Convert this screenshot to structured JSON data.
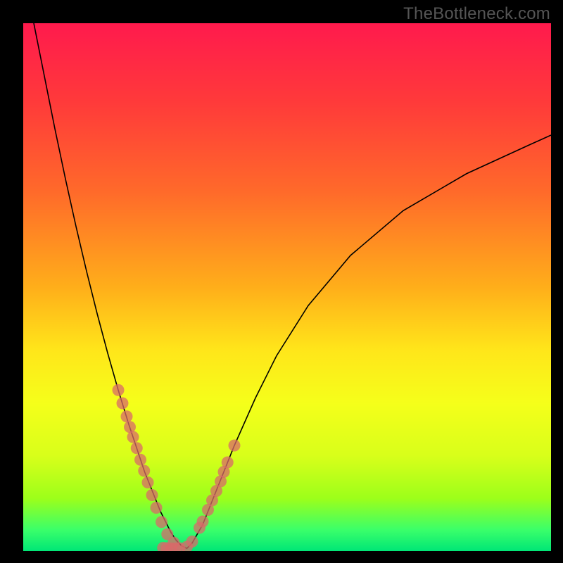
{
  "watermark": "TheBottleneck.com",
  "chart_data": {
    "type": "line",
    "title": "",
    "xlabel": "",
    "ylabel": "",
    "xlim": [
      0,
      100
    ],
    "ylim": [
      0,
      100
    ],
    "curve": {
      "name": "bottleneck-curve",
      "x": [
        2,
        4,
        6,
        8,
        10,
        12,
        14,
        16,
        18,
        20,
        22,
        23,
        24,
        25,
        26,
        27,
        28,
        29,
        30,
        31,
        32,
        34,
        36,
        38,
        40,
        44,
        48,
        54,
        62,
        72,
        84,
        96,
        100
      ],
      "y": [
        100,
        90,
        80,
        70.5,
        61.5,
        53,
        45,
        37.5,
        30.5,
        24,
        18,
        15,
        12.5,
        10,
        7.5,
        5.5,
        3.5,
        2,
        1,
        0.5,
        1.5,
        5,
        10,
        15,
        20,
        29,
        37,
        46.5,
        56,
        64.5,
        71.5,
        77,
        78.8
      ]
    },
    "scatter_left": {
      "name": "left-cluster",
      "x": [
        18.0,
        18.8,
        19.6,
        20.2,
        20.8,
        21.5,
        22.2,
        22.9,
        23.6,
        24.4,
        25.2,
        26.2,
        27.3,
        28.5
      ],
      "y": [
        30.5,
        28.0,
        25.5,
        23.5,
        21.6,
        19.5,
        17.3,
        15.2,
        13.0,
        10.6,
        8.2,
        5.5,
        3.2,
        1.6
      ]
    },
    "scatter_right": {
      "name": "right-cluster",
      "x": [
        31.0,
        32.0,
        33.4,
        34.0,
        35.0,
        35.8,
        36.6,
        37.4,
        38.0,
        38.7,
        40.0
      ],
      "y": [
        0.8,
        1.8,
        4.4,
        5.6,
        7.8,
        9.6,
        11.4,
        13.2,
        15.0,
        16.8,
        20.0
      ]
    },
    "scatter_bottom": {
      "name": "bottom-cluster",
      "x": [
        26.5,
        27.2,
        28.0,
        28.8,
        29.6
      ],
      "y": [
        0.6,
        0.55,
        0.5,
        0.5,
        0.55
      ]
    }
  }
}
